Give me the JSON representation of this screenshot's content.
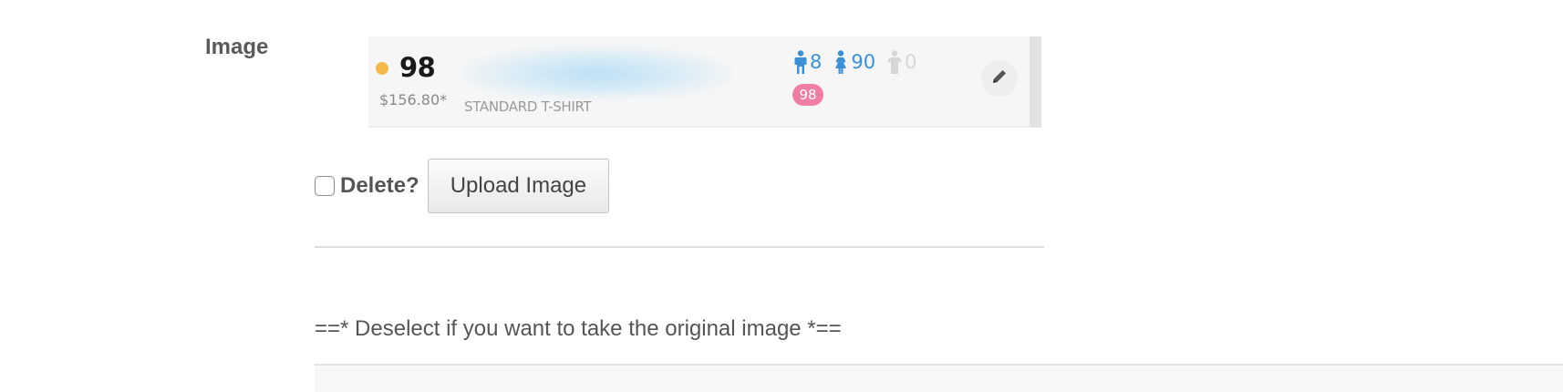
{
  "form": {
    "field_label": "Image",
    "delete_label": "Delete?",
    "upload_button_label": "Upload Image",
    "hint_text": "==* Deselect if you want to take the original image *=="
  },
  "preview": {
    "count": "98",
    "price": "$156.80*",
    "product_type": "STANDARD T-SHIRT",
    "stats": {
      "male": "8",
      "female": "90",
      "unisex": "0"
    },
    "badge": "98",
    "status_dot_color": "#f3b94b",
    "male_color": "#3d8fd6",
    "female_color": "#3d8fd6",
    "unisex_color": "#d6d6d6",
    "badge_color": "#ef7fa2",
    "icons": {
      "male": "male-icon",
      "female": "female-icon",
      "unisex": "shirt-icon",
      "edit": "pencil-icon"
    }
  }
}
